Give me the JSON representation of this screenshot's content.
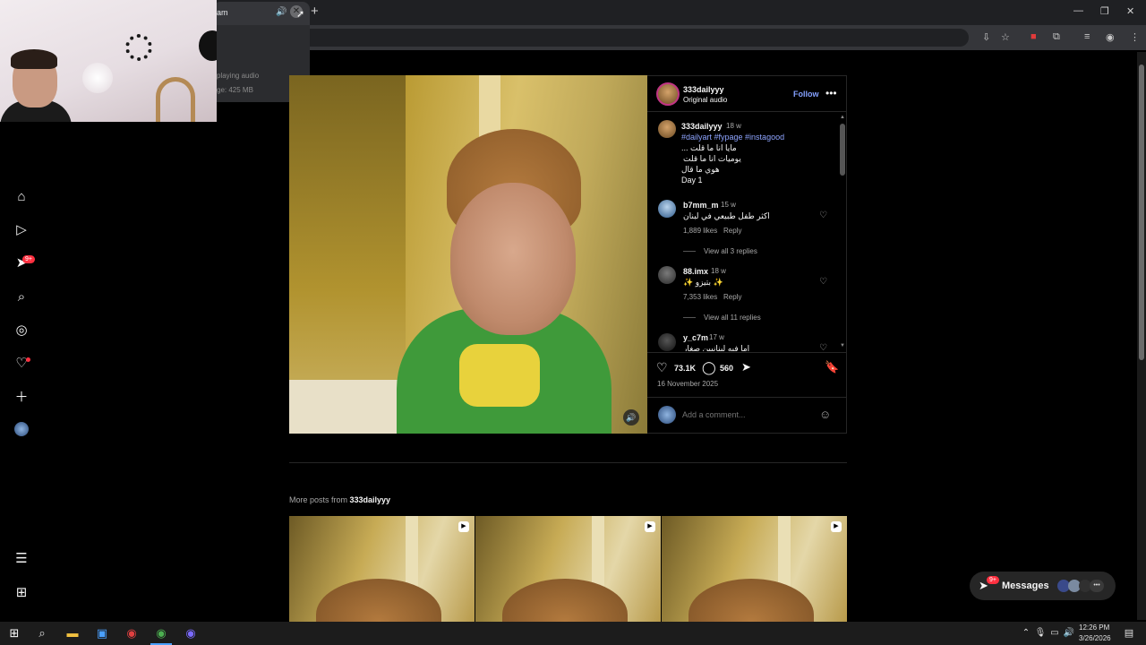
{
  "browser": {
    "tab_title": "am",
    "tab_dropdown": {
      "status": "playing audio",
      "memory": "ge: 425 MB"
    }
  },
  "sidebar": {
    "notification_badge": "9+"
  },
  "post": {
    "author": "333dailyyy",
    "audio": "Original audio",
    "follow_label": "Follow",
    "caption": {
      "username": "333dailyyy",
      "time": "18 w",
      "hashtags": "#dailyart #fypage #instagood",
      "lines": [
        "... مايا انا ما قلت",
        "يوميات انا ما قلت",
        "هوي ما قال",
        "Day 1"
      ]
    },
    "comments": [
      {
        "username": "b7mm_m",
        "time": "15 w",
        "text": "اكثر طفل طبيعي في لبنان",
        "likes": "1,889 likes",
        "reply": "Reply",
        "view_replies": "View all 3 replies"
      },
      {
        "username": "88.imx",
        "time": "18 w",
        "text": "✨ بتيزو ✨",
        "likes": "7,353 likes",
        "reply": "Reply",
        "view_replies": "View all 11 replies"
      },
      {
        "username": "y_c7m",
        "time": "17 w",
        "text": "اما فيه لبنانيين صغار"
      }
    ],
    "likes": "73.1K",
    "comments_count": "560",
    "date": "16 November 2025",
    "add_comment_placeholder": "Add a comment..."
  },
  "more_posts": {
    "prefix": "More posts from ",
    "author": "333dailyyy"
  },
  "messages": {
    "label": "Messages",
    "badge": "9+"
  },
  "taskbar": {
    "time": "12:26 PM",
    "date": "3/26/2026"
  },
  "colors": {
    "accent_link": "#8ea4ff",
    "follow": "#85a1ff",
    "badge": "#ff3040"
  }
}
